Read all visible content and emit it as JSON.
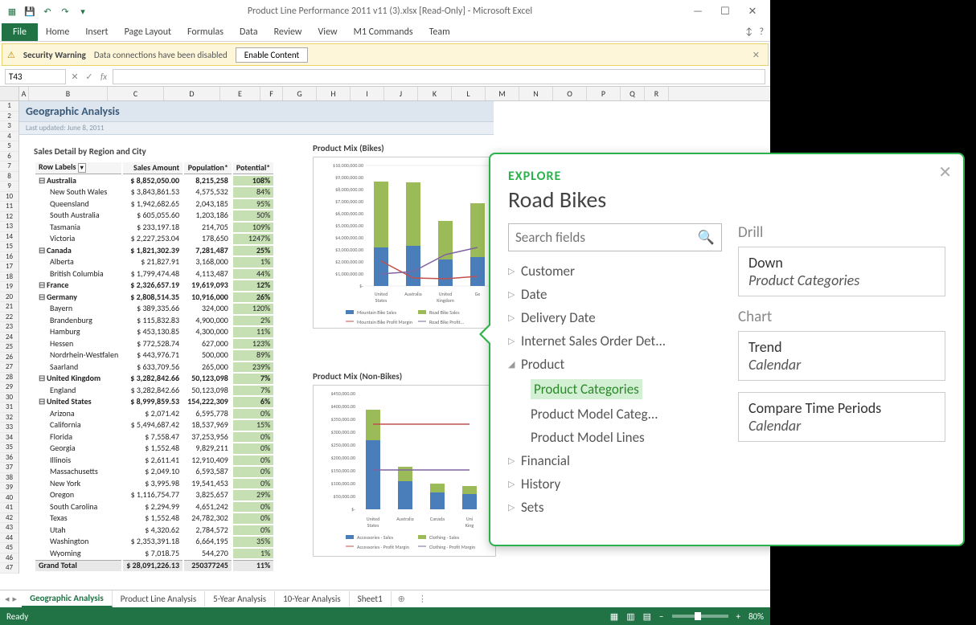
{
  "window": {
    "title": "Product Line Performance 2011 v11 (3).xlsx  [Read-Only] - Microsoft Excel",
    "qat": [
      "excel",
      "save",
      "undo",
      "redo",
      "down"
    ]
  },
  "ribbon": {
    "file": "File",
    "tabs": [
      "Home",
      "Insert",
      "Page Layout",
      "Formulas",
      "Data",
      "Review",
      "View",
      "M1 Commands",
      "Team"
    ]
  },
  "security": {
    "label": "Security Warning",
    "text": "Data connections have been disabled",
    "button": "Enable Content"
  },
  "formula": {
    "namebox": "T43",
    "fx": "fx"
  },
  "columns": [
    "A",
    "B",
    "C",
    "D",
    "E",
    "F",
    "G",
    "H",
    "I",
    "J",
    "K",
    "L",
    "M",
    "N",
    "O",
    "P",
    "Q",
    "R"
  ],
  "geo": {
    "title": "Geographic Analysis",
    "sub": "Last updated: June 8, 2011"
  },
  "sales": {
    "heading": "Sales Detail by Region and City",
    "headers": [
      "Row Labels",
      "Sales Amount",
      "Population*",
      "Potential*"
    ],
    "rows": [
      {
        "t": "country",
        "name": "Australia",
        "sales": "$    8,852,050.00",
        "pop": "8,215,258",
        "pct": "108%"
      },
      {
        "t": "city",
        "name": "New South Wales",
        "sales": "$        3,843,861.53",
        "pop": "4,575,532",
        "pct": "84%"
      },
      {
        "t": "city",
        "name": "Queensland",
        "sales": "$        1,942,682.65",
        "pop": "2,043,185",
        "pct": "95%"
      },
      {
        "t": "city",
        "name": "South Australia",
        "sales": "$           605,055.60",
        "pop": "1,203,186",
        "pct": "50%"
      },
      {
        "t": "city",
        "name": "Tasmania",
        "sales": "$           233,197.18",
        "pop": "214,705",
        "pct": "109%"
      },
      {
        "t": "city",
        "name": "Victoria",
        "sales": "$        2,227,253.04",
        "pop": "178,650",
        "pct": "1247%"
      },
      {
        "t": "country",
        "name": "Canada",
        "sales": "$    1,821,302.39",
        "pop": "7,281,487",
        "pct": "25%"
      },
      {
        "t": "city",
        "name": "Alberta",
        "sales": "$             21,827.91",
        "pop": "3,168,000",
        "pct": "1%"
      },
      {
        "t": "city",
        "name": "British Columbia",
        "sales": "$        1,799,474.48",
        "pop": "4,113,487",
        "pct": "44%"
      },
      {
        "t": "country",
        "name": "France",
        "sales": "$    2,326,657.19",
        "pop": "19,619,093",
        "pct": "12%"
      },
      {
        "t": "country",
        "name": "Germany",
        "sales": "$    2,808,514.35",
        "pop": "10,916,000",
        "pct": "26%"
      },
      {
        "t": "city",
        "name": "Bayern",
        "sales": "$           389,335.66",
        "pop": "324,000",
        "pct": "120%"
      },
      {
        "t": "city",
        "name": "Brandenburg",
        "sales": "$           115,832.83",
        "pop": "4,900,000",
        "pct": "2%"
      },
      {
        "t": "city",
        "name": "Hamburg",
        "sales": "$           453,130.85",
        "pop": "4,300,000",
        "pct": "11%"
      },
      {
        "t": "city",
        "name": "Hessen",
        "sales": "$           772,528.74",
        "pop": "627,000",
        "pct": "123%"
      },
      {
        "t": "city",
        "name": "Nordrhein-Westfalen",
        "sales": "$           443,976.71",
        "pop": "500,000",
        "pct": "89%"
      },
      {
        "t": "city",
        "name": "Saarland",
        "sales": "$           633,709.56",
        "pop": "265,000",
        "pct": "239%"
      },
      {
        "t": "country",
        "name": "United Kingdom",
        "sales": "$    3,282,842.66",
        "pop": "50,123,098",
        "pct": "7%"
      },
      {
        "t": "city",
        "name": "England",
        "sales": "$        3,282,842.66",
        "pop": "50,123,098",
        "pct": "7%"
      },
      {
        "t": "country",
        "name": "United States",
        "sales": "$    8,999,859.53",
        "pop": "154,222,309",
        "pct": "6%"
      },
      {
        "t": "city",
        "name": "Arizona",
        "sales": "$               2,071.42",
        "pop": "6,595,778",
        "pct": "0%"
      },
      {
        "t": "city",
        "name": "California",
        "sales": "$        5,494,687.42",
        "pop": "18,537,969",
        "pct": "15%"
      },
      {
        "t": "city",
        "name": "Florida",
        "sales": "$               7,558.47",
        "pop": "37,253,956",
        "pct": "0%"
      },
      {
        "t": "city",
        "name": "Georgia",
        "sales": "$               1,552.48",
        "pop": "9,829,211",
        "pct": "0%"
      },
      {
        "t": "city",
        "name": "Illinois",
        "sales": "$               2,611.41",
        "pop": "12,910,409",
        "pct": "0%"
      },
      {
        "t": "city",
        "name": "Massachusetts",
        "sales": "$               2,049.10",
        "pop": "6,593,587",
        "pct": "0%"
      },
      {
        "t": "city",
        "name": "New York",
        "sales": "$               3,995.98",
        "pop": "19,541,453",
        "pct": "0%"
      },
      {
        "t": "city",
        "name": "Oregon",
        "sales": "$        1,116,754.77",
        "pop": "3,825,657",
        "pct": "29%"
      },
      {
        "t": "city",
        "name": "South Carolina",
        "sales": "$               2,294.99",
        "pop": "4,651,242",
        "pct": "0%"
      },
      {
        "t": "city",
        "name": "Texas",
        "sales": "$               1,552.48",
        "pop": "24,782,302",
        "pct": "0%"
      },
      {
        "t": "city",
        "name": "Utah",
        "sales": "$               4,320.62",
        "pop": "2,784,572",
        "pct": "0%"
      },
      {
        "t": "city",
        "name": "Washington",
        "sales": "$        2,353,391.18",
        "pop": "6,664,195",
        "pct": "35%"
      },
      {
        "t": "city",
        "name": "Wyoming",
        "sales": "$               7,018.75",
        "pop": "544,270",
        "pct": "1%"
      }
    ],
    "grand": {
      "name": "Grand Total",
      "sales": "$  28,091,226.13",
      "pop": "250377245",
      "pct": "11%"
    }
  },
  "chart1": {
    "title": "Product Mix (Bikes)",
    "legend": [
      "Mountain Bike Sales",
      "Road Bike Sales",
      "Mountain Bike Profit Margin",
      "Road Bike Profit..."
    ]
  },
  "chart2": {
    "title": "Product Mix (Non-Bikes)",
    "legend": [
      "Accessories - Sales",
      "Clothing - Sales",
      "Accessories - Profit Margin",
      "Clothing - Profit Margin"
    ]
  },
  "chart_data": [
    {
      "type": "bar",
      "series": [
        {
          "name": "Mountain Bike Sales",
          "values": [
            3200000,
            3300000,
            2200000,
            2400000
          ]
        },
        {
          "name": "Road Bike Sales",
          "values": [
            5500000,
            5300000,
            3200000,
            4500000
          ]
        }
      ],
      "lines": [
        {
          "name": "Mountain Bike Profit Margin",
          "values": [
            0.21,
            0.07,
            0.06,
            0.08
          ]
        },
        {
          "name": "Road Bike Profit Margin",
          "values": [
            0.1,
            0.12,
            0.26,
            0.32
          ]
        }
      ],
      "categories": [
        "United States",
        "Australia",
        "United Kingdom",
        "Germany"
      ],
      "ylabel": "",
      "ylim": [
        0,
        10000000
      ],
      "yticks": [
        "$-",
        "$1,000,000.00",
        "$2,000,000.00",
        "$3,000,000.00",
        "$4,000,000.00",
        "$5,000,000.00",
        "$6,000,000.00",
        "$7,000,000.00",
        "$8,000,000.00",
        "$9,000,000.00",
        "$10,000,000.00"
      ]
    },
    {
      "type": "bar",
      "series": [
        {
          "name": "Accessories - Sales",
          "values": [
            270000,
            110000,
            65000,
            60000
          ]
        },
        {
          "name": "Clothing - Sales",
          "values": [
            120000,
            55000,
            35000,
            30000
          ]
        }
      ],
      "lines": [
        {
          "name": "Accessories - Profit Margin",
          "values": [
            0.68,
            0.68,
            0.68,
            0.68
          ]
        },
        {
          "name": "Clothing - Profit Margin",
          "values": [
            0.32,
            0.32,
            0.32,
            0.32
          ]
        }
      ],
      "categories": [
        "United States",
        "Australia",
        "Canada",
        "United Kingdom"
      ],
      "ylabel": "",
      "ylim": [
        0,
        450000
      ],
      "yticks": [
        "$-",
        "$50,000.00",
        "$100,000.00",
        "$150,000.00",
        "$200,000.00",
        "$250,000.00",
        "$300,000.00",
        "$350,000.00",
        "$400,000.00",
        "$450,000.00"
      ]
    }
  ],
  "sheetTabs": [
    "Geographic Analysis",
    "Product Line Analysis",
    "5-Year Analysis",
    "10-Year Analysis",
    "Sheet1"
  ],
  "status": {
    "ready": "Ready",
    "zoom": "80%"
  },
  "explore": {
    "label": "EXPLORE",
    "title": "Road Bikes",
    "search_placeholder": "Search fields",
    "fields": [
      {
        "name": "Customer",
        "expanded": false
      },
      {
        "name": "Date",
        "expanded": false
      },
      {
        "name": "Delivery Date",
        "expanded": false
      },
      {
        "name": "Internet Sales Order Det...",
        "expanded": false
      },
      {
        "name": "Product",
        "expanded": true,
        "children": [
          "Product Categories",
          "Product Model Categ...",
          "Product Model Lines"
        ]
      },
      {
        "name": "Financial",
        "expanded": false
      },
      {
        "name": "History",
        "expanded": false
      },
      {
        "name": "Sets",
        "expanded": false
      }
    ],
    "drill": {
      "heading": "Drill",
      "action": "Down",
      "target": "Product Categories"
    },
    "chart": {
      "heading": "Chart",
      "action": "Trend",
      "target": "Calendar"
    },
    "compare": {
      "action": "Compare Time Periods",
      "target": "Calendar"
    }
  }
}
